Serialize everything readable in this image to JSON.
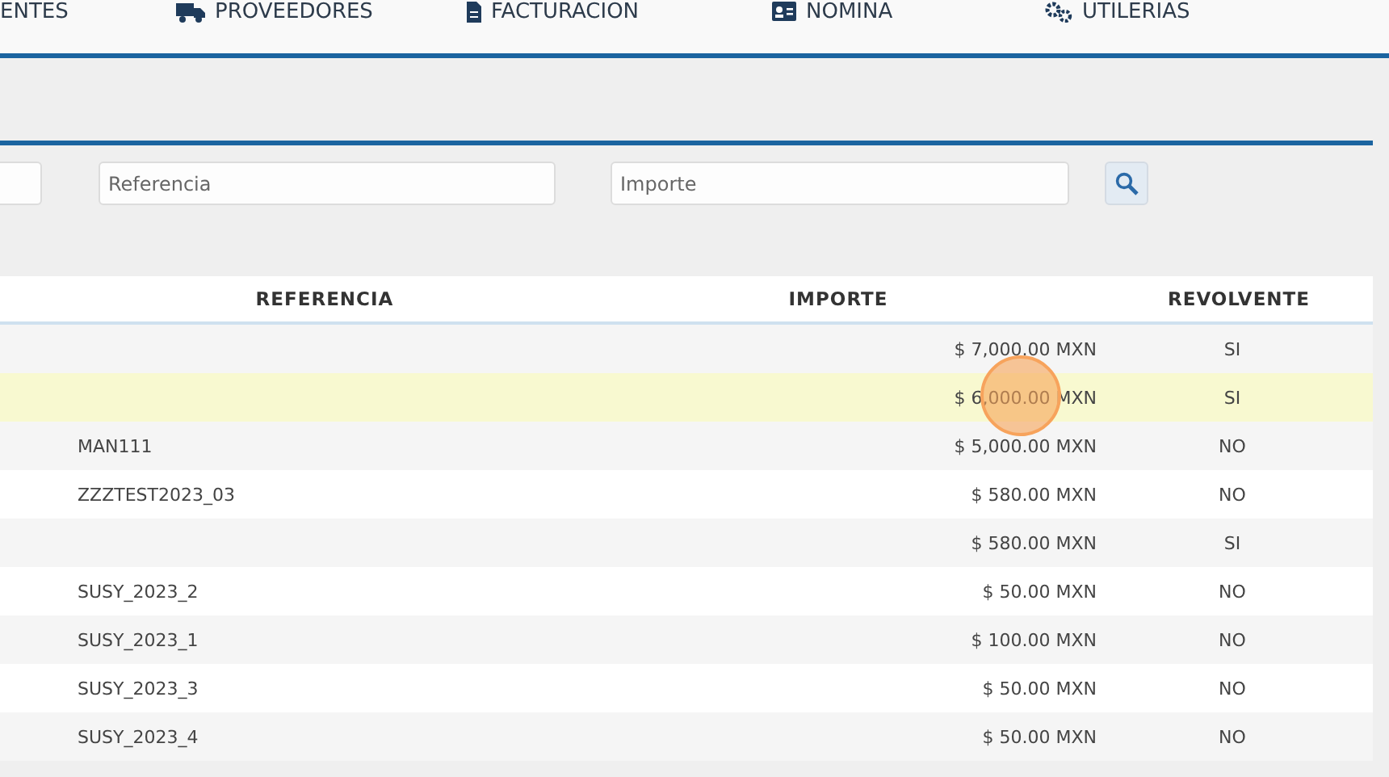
{
  "nav": [
    {
      "label": "ENTES",
      "kind": "plain"
    },
    {
      "label": "PROVEEDORES",
      "kind": "truck"
    },
    {
      "label": "FACTURACION",
      "kind": "file"
    },
    {
      "label": "NOMINA",
      "kind": "idcard"
    },
    {
      "label": "UTILERIAS",
      "kind": "gears"
    }
  ],
  "filters": {
    "referencia": {
      "placeholder": "Referencia"
    },
    "importe": {
      "placeholder": "Importe"
    }
  },
  "table": {
    "columns": [
      "REFERENCIA",
      "IMPORTE",
      "REVOLVENTE"
    ],
    "rows": [
      {
        "referencia": "",
        "importe": "$ 7,000.00 MXN",
        "revolvente": "SI",
        "selected": false
      },
      {
        "referencia": "",
        "importe": "$ 6,000.00 MXN",
        "revolvente": "SI",
        "selected": true
      },
      {
        "referencia": "MAN111",
        "importe": "$ 5,000.00 MXN",
        "revolvente": "NO",
        "selected": false
      },
      {
        "referencia": "ZZZTEST2023_03",
        "importe": "$ 580.00 MXN",
        "revolvente": "NO",
        "selected": false
      },
      {
        "referencia": "",
        "importe": "$ 580.00 MXN",
        "revolvente": "SI",
        "selected": false
      },
      {
        "referencia": "SUSY_2023_2",
        "importe": "$ 50.00 MXN",
        "revolvente": "NO",
        "selected": false
      },
      {
        "referencia": "SUSY_2023_1",
        "importe": "$ 100.00 MXN",
        "revolvente": "NO",
        "selected": false
      },
      {
        "referencia": "SUSY_2023_3",
        "importe": "$ 50.00 MXN",
        "revolvente": "NO",
        "selected": false
      },
      {
        "referencia": "SUSY_2023_4",
        "importe": "$ 50.00 MXN",
        "revolvente": "NO",
        "selected": false
      }
    ]
  }
}
